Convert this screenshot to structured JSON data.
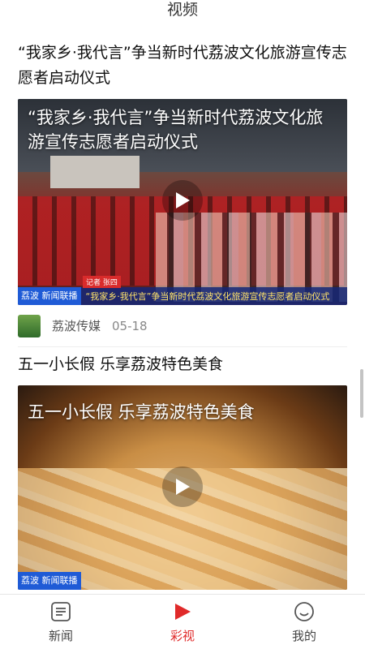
{
  "header": {
    "title": "视频"
  },
  "feed": [
    {
      "title": "“我家乡·我代言”争当新时代荔波文化旅游宣传志愿者启动仪式",
      "overlay_title": "“我家乡·我代言”争当新时代荔波文化旅游宣传志愿者启动仪式",
      "ticker_logo": "荔波 新闻联播",
      "ticker_text": "“我家乡·我代言”争当新时代荔波文化旅游宣传志愿者启动仪式",
      "ticker_tag": "记者 张四",
      "source": "荔波传媒",
      "date": "05-18"
    },
    {
      "title": "五一小长假 乐享荔波特色美食",
      "overlay_title": "五一小长假 乐享荔波特色美食",
      "ticker_logo": "荔波 新闻联播"
    }
  ],
  "tabbar": {
    "tabs": [
      {
        "label": "新闻",
        "icon": "news-icon"
      },
      {
        "label": "彩视",
        "icon": "video-play-icon",
        "active": true
      },
      {
        "label": "我的",
        "icon": "smile-icon"
      }
    ]
  },
  "colors": {
    "accent": "#e02a2a",
    "text": "#222222",
    "muted": "#888888"
  }
}
